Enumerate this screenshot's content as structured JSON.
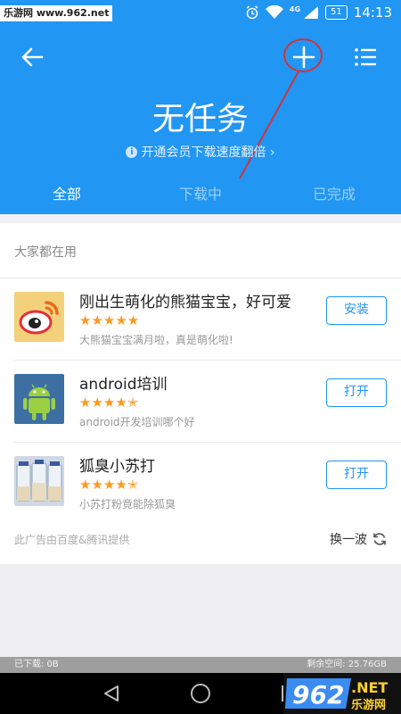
{
  "statusbar": {
    "watermark": "乐游网 www.962.net",
    "network": "4G",
    "battery": "51",
    "time": "14:13"
  },
  "header": {
    "title": "无任务",
    "promo": "开通会员下载速度翻倍 ›",
    "tabs": [
      {
        "label": "全部",
        "active": true
      },
      {
        "label": "下载中",
        "active": false
      },
      {
        "label": "已完成",
        "active": false
      }
    ]
  },
  "recommend": {
    "section_title": "大家都在用",
    "apps": [
      {
        "name": "刚出生萌化的熊猫宝宝，好可爱",
        "rating": "★★★★★",
        "desc": "大熊猫宝宝满月啦，真是萌化啦!",
        "action": "安装",
        "icon": "weibo-icon"
      },
      {
        "name": "android培训",
        "rating": "★★★★✭",
        "desc": "android开发培训哪个好",
        "action": "打开",
        "icon": "android-icon"
      },
      {
        "name": "狐臭小苏打",
        "rating": "★★★★✭",
        "desc": "小苏打粉竟能除狐臭",
        "action": "打开",
        "icon": "bottles-icon"
      }
    ],
    "ad_note": "此广告由百度&腾讯提供",
    "refresh_label": "换一波"
  },
  "storage": {
    "downloaded": "已下载: 0B",
    "free": "剩余空间: 25.76GB"
  },
  "colors": {
    "primary": "#2196f3",
    "star": "#ff9a1f",
    "annotation": "#d2323c"
  }
}
